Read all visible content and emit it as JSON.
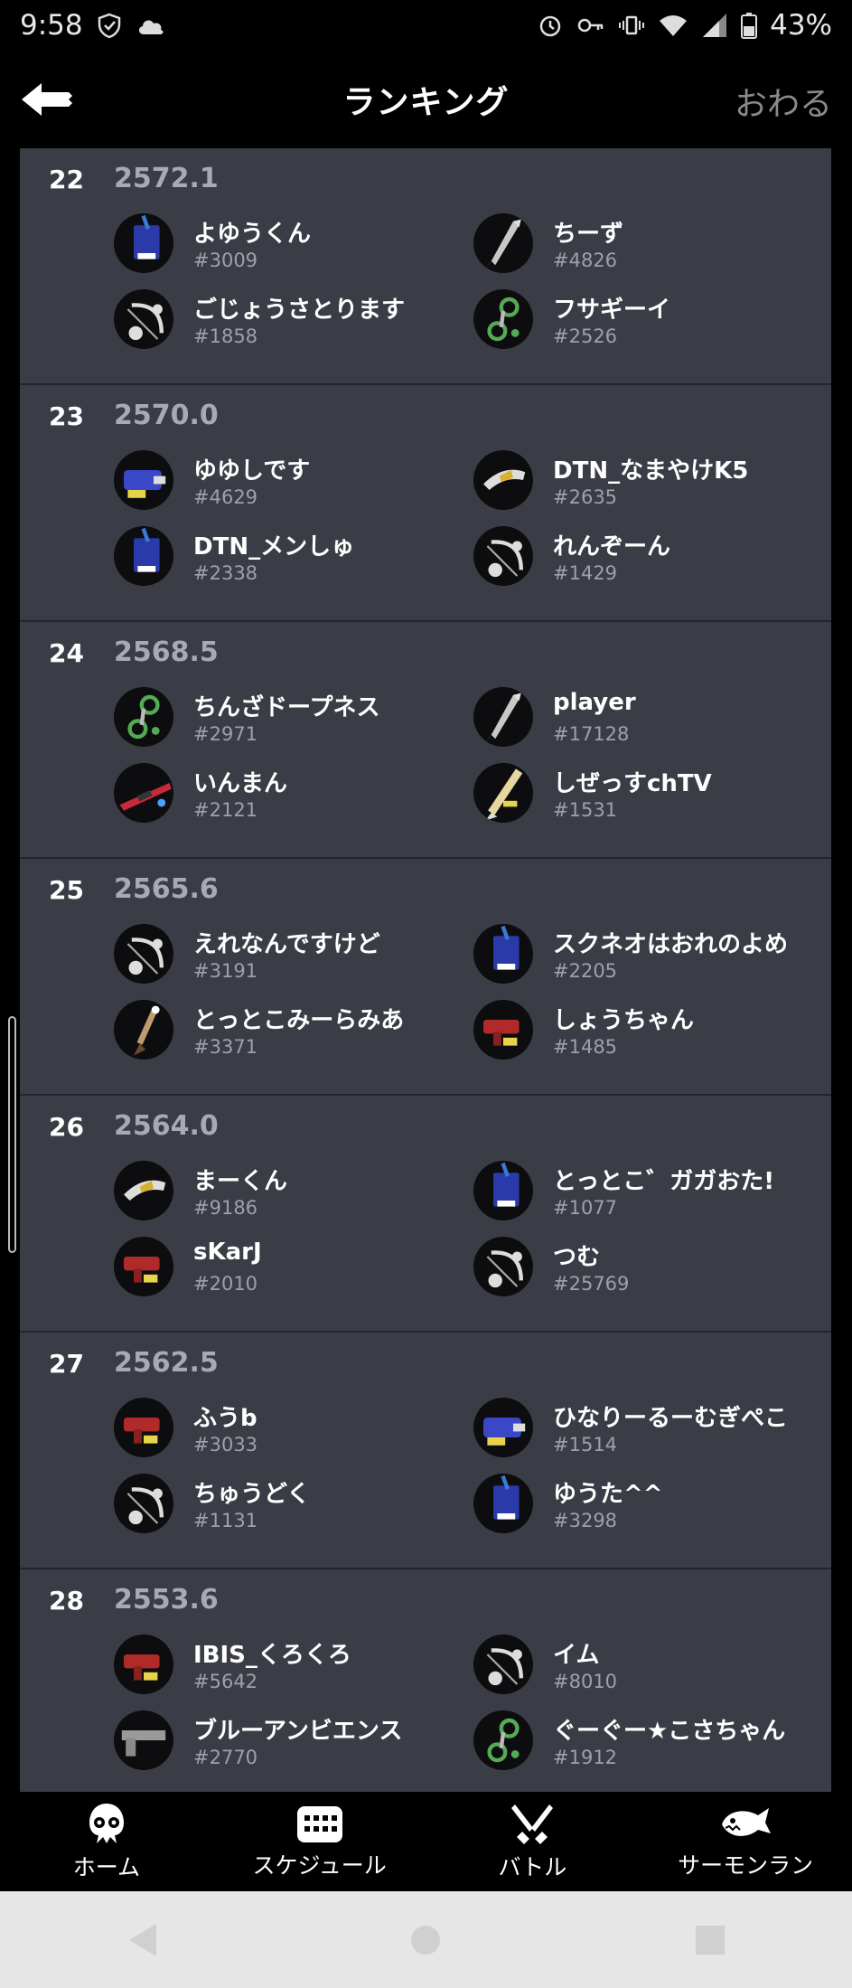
{
  "status_bar": {
    "time": "9:58",
    "battery": "43%"
  },
  "header": {
    "title": "ランキング",
    "finish_label": "おわる"
  },
  "colors": {
    "background": "#3a3d45",
    "bar": "#000000",
    "score": "#a7aab2"
  },
  "rankings": [
    {
      "rank": "22",
      "score": "2572.1",
      "players": [
        {
          "name": "よゆうくん",
          "tag": "#3009",
          "weapon": "roller-icon"
        },
        {
          "name": "ちーず",
          "tag": "#4826",
          "weapon": "drill-icon"
        },
        {
          "name": "ごじょうさとります",
          "tag": "#1858",
          "weapon": "bow-icon"
        },
        {
          "name": "フサギーイ",
          "tag": "#2526",
          "weapon": "splatling-icon"
        }
      ]
    },
    {
      "rank": "23",
      "score": "2570.0",
      "players": [
        {
          "name": "ゆゆしです",
          "tag": "#4629",
          "weapon": "blaster-icon"
        },
        {
          "name": "DTN_なまやけK5",
          "tag": "#2635",
          "weapon": "dualie-icon"
        },
        {
          "name": "DTN_メンしゅ",
          "tag": "#2338",
          "weapon": "roller-icon"
        },
        {
          "name": "れんぞーん",
          "tag": "#1429",
          "weapon": "bow-icon"
        }
      ]
    },
    {
      "rank": "24",
      "score": "2568.5",
      "players": [
        {
          "name": "ちんざドープネス",
          "tag": "#2971",
          "weapon": "splatling-icon"
        },
        {
          "name": "player",
          "tag": "#17128",
          "weapon": "drill-icon"
        },
        {
          "name": "いんまん",
          "tag": "#2121",
          "weapon": "charger-icon"
        },
        {
          "name": "しぜっすchTV",
          "tag": "#1531",
          "weapon": "brush-icon"
        }
      ]
    },
    {
      "rank": "25",
      "score": "2565.6",
      "players": [
        {
          "name": "えれなんですけど",
          "tag": "#3191",
          "weapon": "bow-icon"
        },
        {
          "name": "スクネオはおれのよめ",
          "tag": "#2205",
          "weapon": "roller-icon"
        },
        {
          "name": "とっとこみーらみあ",
          "tag": "#3371",
          "weapon": "inkbrush-icon"
        },
        {
          "name": "しょうちゃん",
          "tag": "#1485",
          "weapon": "shooter-icon"
        }
      ]
    },
    {
      "rank": "26",
      "score": "2564.0",
      "players": [
        {
          "name": "まーくん",
          "tag": "#9186",
          "weapon": "dualie-icon"
        },
        {
          "name": "とっとこ゛ガガおた!",
          "tag": "#1077",
          "weapon": "roller-icon"
        },
        {
          "name": "sKarJ",
          "tag": "#2010",
          "weapon": "shooter-icon"
        },
        {
          "name": "つむ",
          "tag": "#25769",
          "weapon": "bow-icon"
        }
      ]
    },
    {
      "rank": "27",
      "score": "2562.5",
      "players": [
        {
          "name": "ふうb",
          "tag": "#3033",
          "weapon": "shooter-icon"
        },
        {
          "name": "ひなりーるーむぎぺこ",
          "tag": "#1514",
          "weapon": "blaster-icon"
        },
        {
          "name": "ちゅうどく",
          "tag": "#1131",
          "weapon": "bow-icon"
        },
        {
          "name": "ゆうた^^",
          "tag": "#3298",
          "weapon": "roller-icon"
        }
      ]
    },
    {
      "rank": "28",
      "score": "2553.6",
      "players": [
        {
          "name": "IBIS_くろくろ",
          "tag": "#5642",
          "weapon": "shooter-icon"
        },
        {
          "name": "イム",
          "tag": "#8010",
          "weapon": "bow-icon"
        },
        {
          "name": "ブルーアンビエンス",
          "tag": "#2770",
          "weapon": "pistol-icon"
        },
        {
          "name": "ぐーぐー★こさちゃん",
          "tag": "#1912",
          "weapon": "splatling-icon"
        }
      ]
    }
  ],
  "bottom_nav": [
    {
      "label": "ホーム",
      "icon": "squid-icon"
    },
    {
      "label": "スケジュール",
      "icon": "calendar-icon"
    },
    {
      "label": "バトル",
      "icon": "crossed-weapons-icon"
    },
    {
      "label": "サーモンラン",
      "icon": "salmon-icon"
    }
  ]
}
